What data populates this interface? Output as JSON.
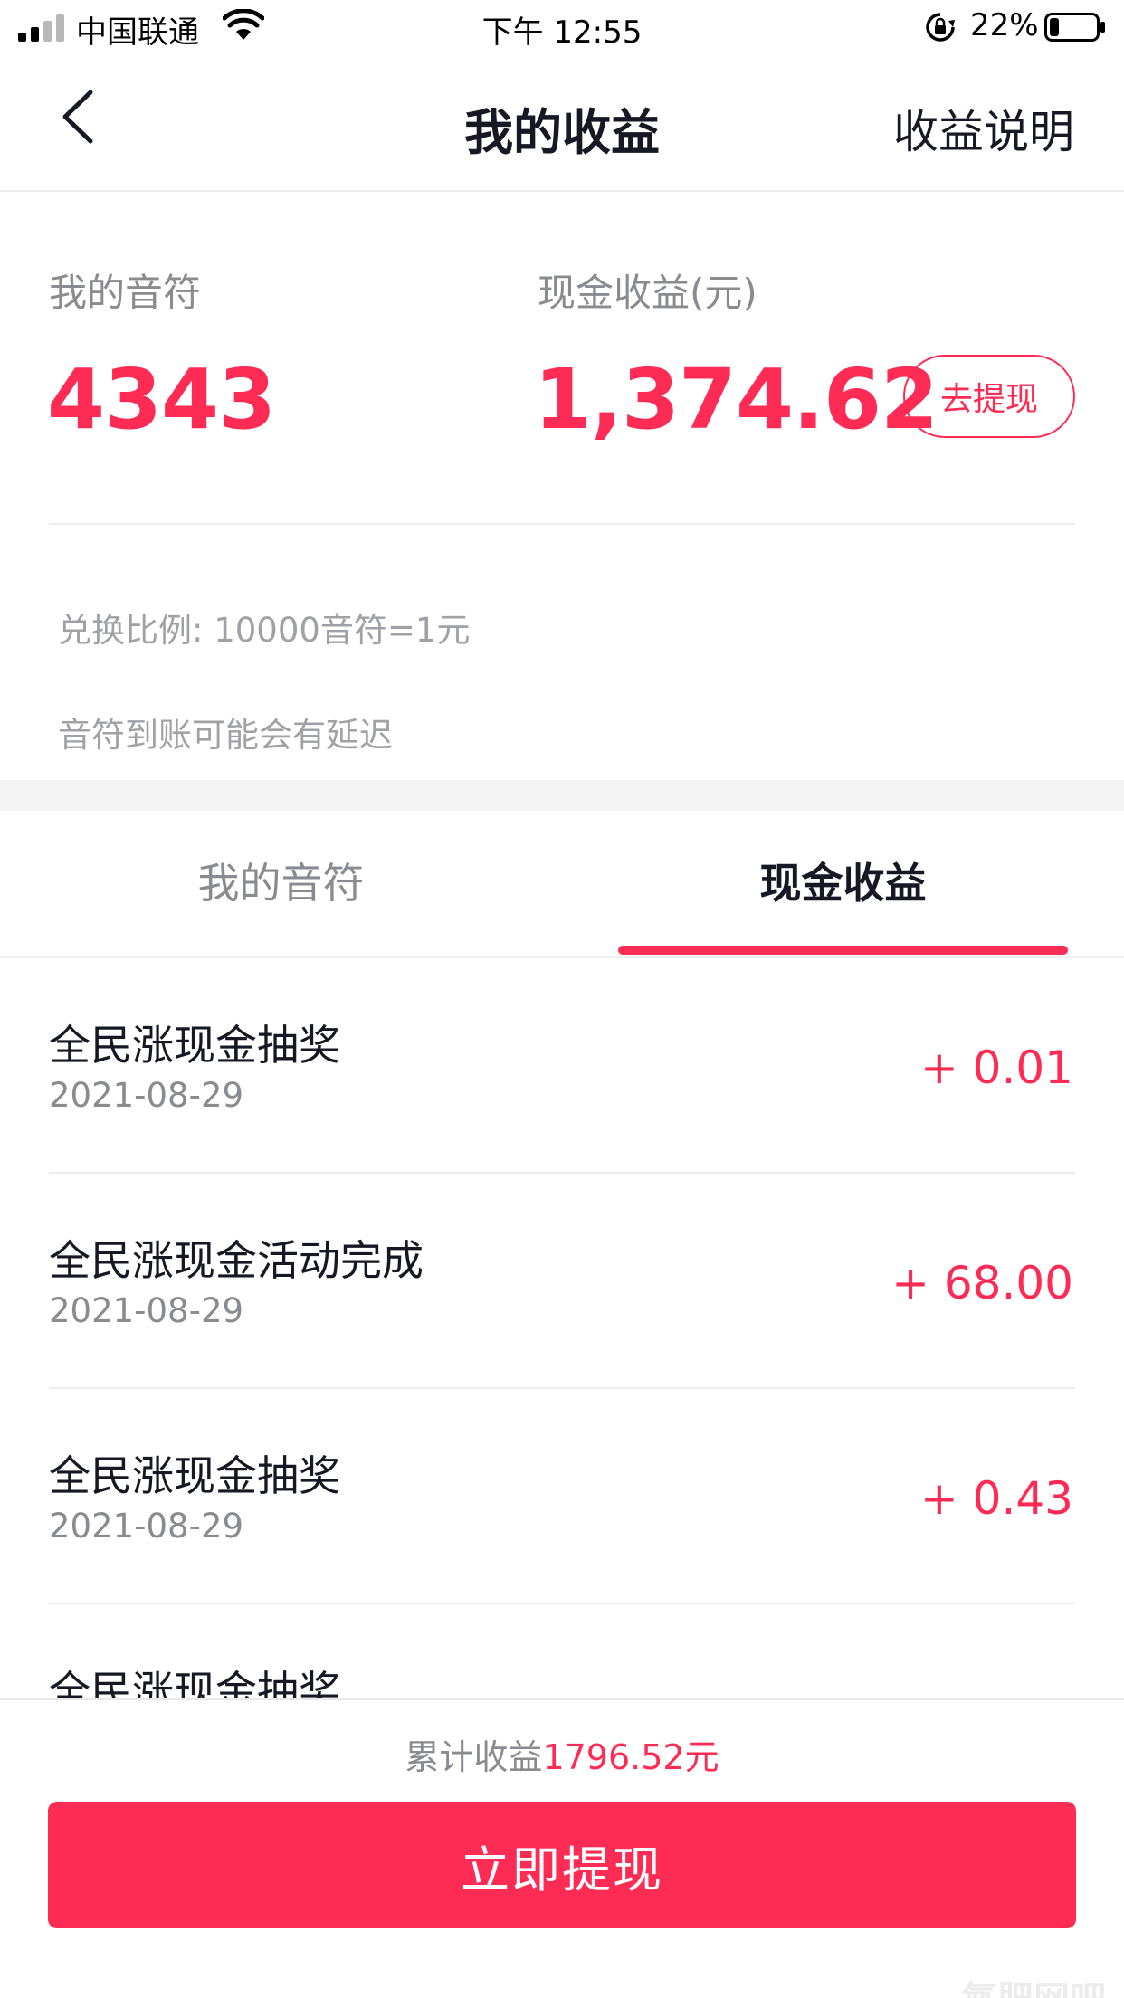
{
  "status_bar": {
    "carrier": "中国联通",
    "time": "下午 12:55",
    "battery_percent": "22%",
    "signal_icon": "signal-icon",
    "wifi_icon": "wifi-icon",
    "lock_icon": "orientation-lock-icon",
    "battery_icon": "battery-icon"
  },
  "nav": {
    "back_icon": "chevron-left-icon",
    "title": "我的收益",
    "right_link": "收益说明"
  },
  "summary": {
    "notes_label": "我的音符",
    "notes_value": "4343",
    "cash_label": "现金收益(元)",
    "cash_value": "1,374.62",
    "withdraw_pill": "去提现",
    "exchange_rate": "兑换比例: 10000音符=1元",
    "delay_notice": "音符到账可能会有延迟"
  },
  "tabs": [
    {
      "label": "我的音符",
      "active": false
    },
    {
      "label": "现金收益",
      "active": true
    }
  ],
  "transactions": [
    {
      "title": "全民涨现金抽奖",
      "date": "2021-08-29",
      "amount": "+ 0.01"
    },
    {
      "title": "全民涨现金活动完成",
      "date": "2021-08-29",
      "amount": "+ 68.00"
    },
    {
      "title": "全民涨现金抽奖",
      "date": "2021-08-29",
      "amount": "+ 0.43"
    },
    {
      "title": "全民涨现金抽奖",
      "date": "",
      "amount": ""
    }
  ],
  "footer": {
    "total_label": "累计收益",
    "total_value": "1796.52元",
    "cta": "立即提现",
    "watermark": "氮肥网吧"
  },
  "colors": {
    "accent": "#fe2c55",
    "text_primary": "#161823",
    "text_secondary": "#8a8b91"
  }
}
